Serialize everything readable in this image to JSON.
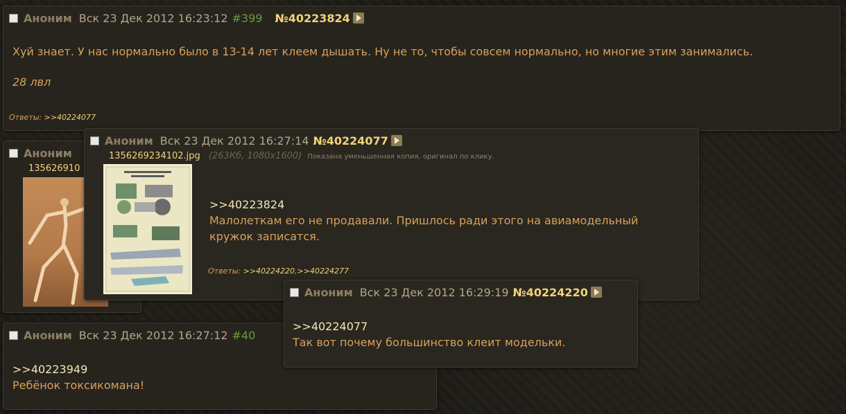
{
  "posts": {
    "p399": {
      "name": "Аноним",
      "date": "Вск 23 Дек 2012 16:23:12",
      "index": "#399",
      "number": "№40223824",
      "text": "Хуй знает. У нас нормально было в 13-14 лет клеем дышать. Ну не то, чтобы совсем нормально, но многие этим занимались.",
      "signature": "28 лвл",
      "answers_label": "Ответы:",
      "answers": ">>40224077"
    },
    "p400": {
      "name": "Аноним",
      "file": "135626910",
      "figure": "Photo of a stick figure made of twisted straws"
    },
    "p401": {
      "name": "Аноним",
      "date": "Вск 23 Дек 2012 16:27:12",
      "index": "#40",
      "ref": ">>40223949",
      "text": "Ребёнок токсикомана!"
    },
    "popup1": {
      "name": "Аноним",
      "date": "Вск 23 Дек 2012 16:27:14",
      "number": "№40224077",
      "file_name": "1356269234102.jpg",
      "file_meta": "(263Кб, 1080x1600)",
      "file_note": "Показана уменьшенная копия, оригинал по клику.",
      "ref": ">>40223824",
      "text_line1": "Малолеткам его не продавали. Пришлось ради этого на авиамодельный",
      "text_line2": "кружок записатся.",
      "answers_label": "Ответы:",
      "answer1": ">>40224220",
      "answer_sep": ",",
      "answer2": ">>40224277",
      "figure": "Poster showing airplane engine installation on models"
    },
    "popup2": {
      "name": "Аноним",
      "date": "Вск 23 Дек 2012 16:29:19",
      "number": "№40224220",
      "ref": ">>40224077",
      "text": "Так вот почему большинство клеит модельки."
    }
  }
}
